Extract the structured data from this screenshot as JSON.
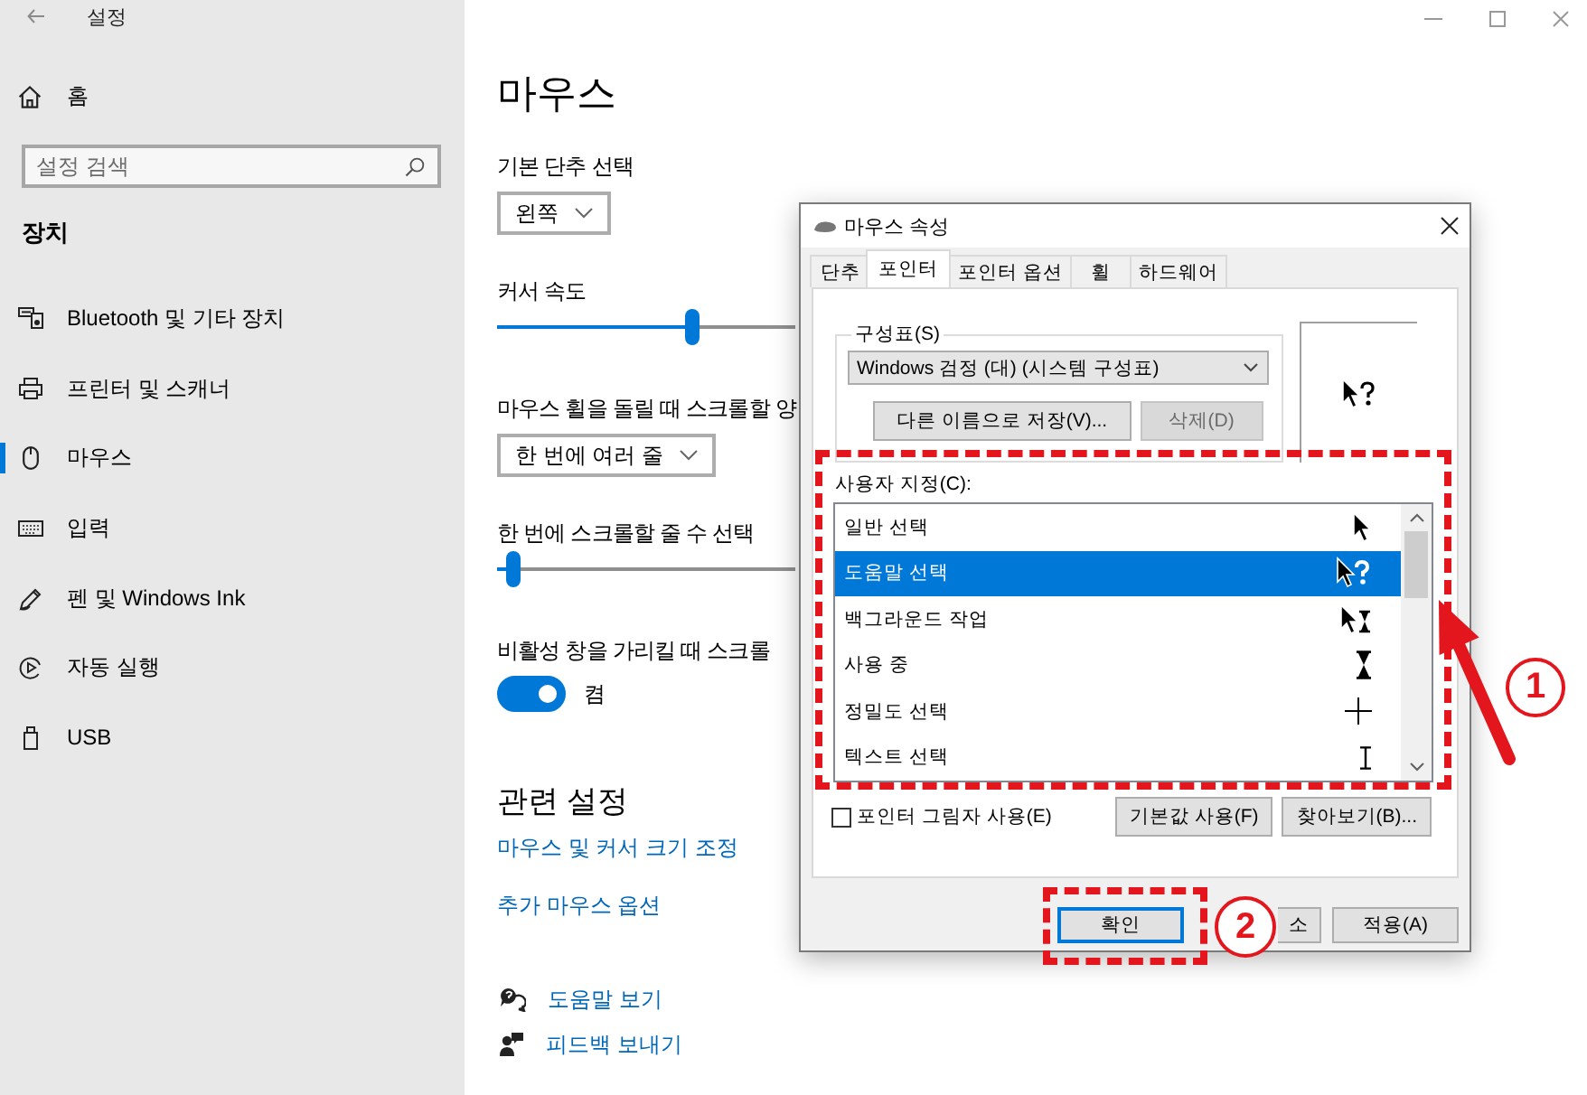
{
  "window": {
    "title": "설정"
  },
  "sidebar": {
    "home": "홈",
    "search": {
      "placeholder": "설정 검색"
    },
    "section": "장치",
    "items": [
      {
        "label": "Bluetooth 및 기타 장치",
        "selected": false
      },
      {
        "label": "프린터 및 스캐너",
        "selected": false
      },
      {
        "label": "마우스",
        "selected": true
      },
      {
        "label": "입력",
        "selected": false
      },
      {
        "label": "펜 및 Windows Ink",
        "selected": false
      },
      {
        "label": "자동 실행",
        "selected": false
      },
      {
        "label": "USB",
        "selected": false
      }
    ]
  },
  "page": {
    "title": "마우스",
    "settings": [
      {
        "kind": "dropdown",
        "label": "기본 단추 선택",
        "value": "왼쪽"
      },
      {
        "kind": "slider",
        "label": "커서 속도",
        "level": 0.66
      },
      {
        "kind": "dropdown",
        "label": "마우스 휠을 돌릴 때 스크롤할 양",
        "value": "한 번에 여러 줄"
      },
      {
        "kind": "slider",
        "label": "한 번에 스크롤할 줄 수 선택",
        "level": 0.03
      },
      {
        "kind": "toggle",
        "label": "비활성 창을 가리킬 때 스크롤",
        "on": true,
        "state_text": "켬"
      }
    ],
    "related": {
      "title": "관련 설정",
      "links": [
        "마우스 및 커서 크기 조정",
        "추가 마우스 옵션"
      ]
    },
    "help_links": [
      "도움말 보기",
      "피드백 보내기"
    ]
  },
  "dialog": {
    "title": "마우스 속성",
    "tabs": [
      {
        "label": "단추",
        "selected": false
      },
      {
        "label": "포인터",
        "selected": true
      },
      {
        "label": "포인터 옵션",
        "selected": false
      },
      {
        "label": "휠",
        "selected": false
      },
      {
        "label": "하드웨어",
        "selected": false
      }
    ],
    "scheme": {
      "label": "구성표(S)",
      "value": "Windows 검정 (대) (시스템 구성표)",
      "buttons": [
        {
          "label": "다른 이름으로 저장(V)...",
          "disabled": false
        },
        {
          "label": "삭제(D)",
          "disabled": true
        }
      ]
    },
    "customize": {
      "label": "사용자 지정(C):",
      "rows": [
        {
          "label": "일반 선택",
          "selected": false
        },
        {
          "label": "도움말 선택",
          "selected": true
        },
        {
          "label": "백그라운드 작업",
          "selected": false
        },
        {
          "label": "사용 중",
          "selected": false
        },
        {
          "label": "정밀도 선택",
          "selected": false
        },
        {
          "label": "텍스트 선택",
          "selected": false
        }
      ]
    },
    "shadow": {
      "label": "포인터 그림자 사용(E)",
      "checked": false
    },
    "list_buttons": [
      "기본값 사용(F)",
      "찾아보기(B)..."
    ],
    "buttons": [
      {
        "label": "확인",
        "default": true
      },
      {
        "label": "소",
        "default": false
      },
      {
        "label": "적용(A)",
        "default": false
      }
    ]
  },
  "annotations": {
    "callouts": [
      "1",
      "2"
    ]
  }
}
